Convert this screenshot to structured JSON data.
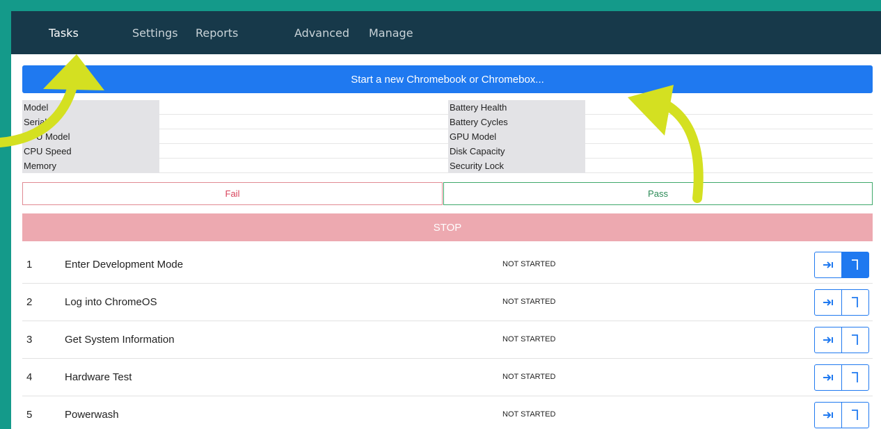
{
  "nav": {
    "items": [
      {
        "label": "Tasks",
        "active": true
      },
      {
        "label": "Settings",
        "active": false
      },
      {
        "label": "Reports",
        "active": false
      },
      {
        "label": "Advanced",
        "active": false
      },
      {
        "label": "Manage",
        "active": false
      }
    ]
  },
  "start_button": "Start a new Chromebook or Chromebox...",
  "info": {
    "left_labels": [
      "Model",
      "Serial",
      "CPU Model",
      "CPU Speed",
      "Memory"
    ],
    "right_labels": [
      "Battery Health",
      "Battery Cycles",
      "GPU Model",
      "Disk Capacity",
      "Security Lock"
    ]
  },
  "fail_label": "Fail",
  "pass_label": "Pass",
  "stop_label": "STOP",
  "tasks": [
    {
      "num": "1",
      "name": "Enter Development Mode",
      "status": "NOT STARTED"
    },
    {
      "num": "2",
      "name": "Log into ChromeOS",
      "status": "NOT STARTED"
    },
    {
      "num": "3",
      "name": "Get System Information",
      "status": "NOT STARTED"
    },
    {
      "num": "4",
      "name": "Hardware Test",
      "status": "NOT STARTED"
    },
    {
      "num": "5",
      "name": "Powerwash",
      "status": "NOT STARTED"
    }
  ],
  "colors": {
    "border": "#149a8a",
    "nav_bg": "#17394a",
    "primary": "#1f79f0",
    "fail": "#d8425a",
    "pass": "#2b8a56",
    "stop_bg": "#eda9b0",
    "annotation_arrow": "#d4e021"
  },
  "icons": {
    "skip_button": "arrow-right-to-bar-icon",
    "jump_button": "corner-down-icon"
  }
}
